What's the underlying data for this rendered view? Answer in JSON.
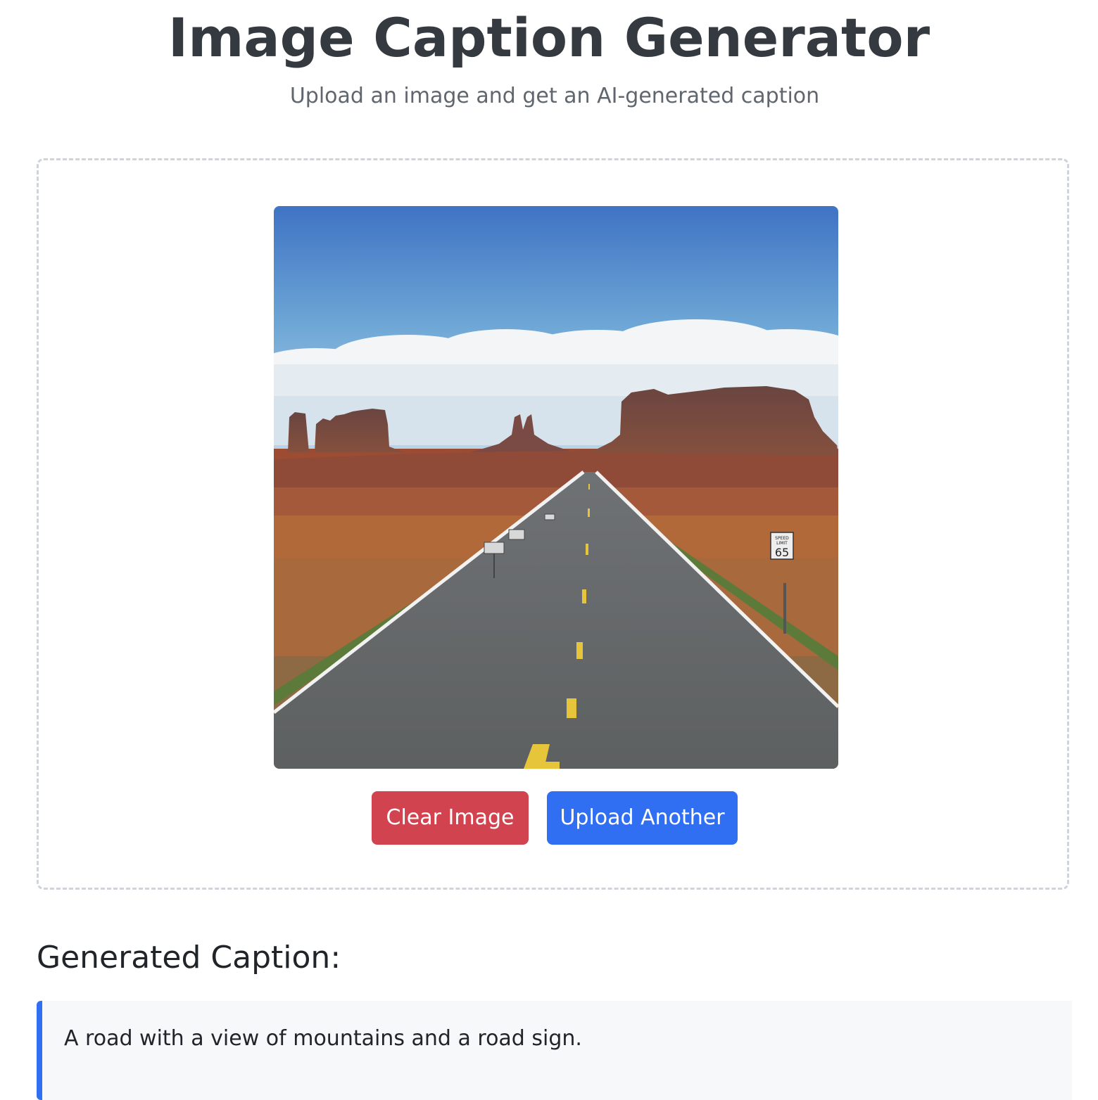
{
  "header": {
    "title": "Image Caption Generator",
    "subtitle": "Upload an image and get an AI-generated caption"
  },
  "upload": {
    "preview_icon": "uploaded-photo-road-desert",
    "sign_top": "SPEED",
    "sign_mid": "LIMIT",
    "sign_num": "65"
  },
  "actions": {
    "clear_label": "Clear Image",
    "upload_label": "Upload Another"
  },
  "result": {
    "heading": "Generated Caption:",
    "caption": "A road with a view of mountains and a road sign."
  },
  "colors": {
    "clear_button": "#d0434f",
    "upload_button": "#306ef2",
    "caption_accent": "#306ef2",
    "caption_background": "#f7f8fa",
    "dashed_border": "#ced4da"
  }
}
